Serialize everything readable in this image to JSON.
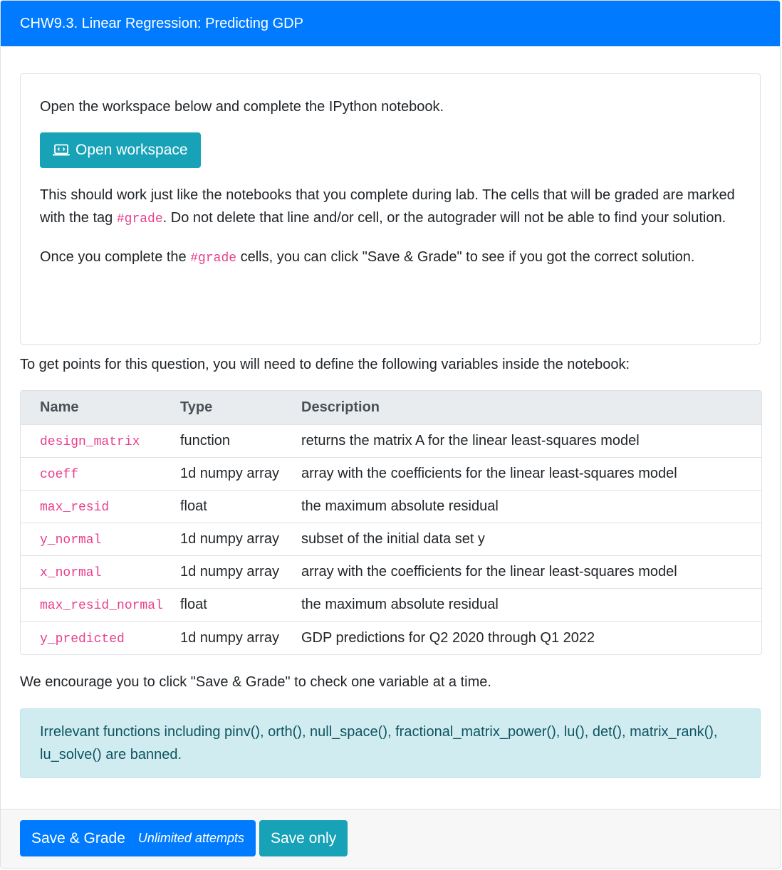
{
  "header": {
    "title": "CHW9.3. Linear Regression: Predicting GDP"
  },
  "workspace": {
    "intro": "Open the workspace below and complete the IPython notebook.",
    "button_label": "Open workspace",
    "para1_a": "This should work just like the notebooks that you complete during lab. The cells that will be graded are marked with the tag ",
    "para1_code": "#grade",
    "para1_b": ". Do not delete that line and/or cell, or the autograder will not be able to find your solution.",
    "para2_a": "Once you complete the ",
    "para2_code": "#grade",
    "para2_b": " cells, you can click \"Save & Grade\" to see if you got the correct solution."
  },
  "variables_intro": "To get points for this question, you will need to define the following variables inside the notebook:",
  "table": {
    "headers": [
      "Name",
      "Type",
      "Description"
    ],
    "rows": [
      {
        "name": "design_matrix",
        "type": "function",
        "description": "returns the matrix A for the linear least-squares model"
      },
      {
        "name": "coeff",
        "type": "1d numpy array",
        "description": "array with the coefficients for the linear least-squares model"
      },
      {
        "name": "max_resid",
        "type": "float",
        "description": "the maximum absolute residual"
      },
      {
        "name": "y_normal",
        "type": "1d numpy array",
        "description": "subset of the initial data set y"
      },
      {
        "name": "x_normal",
        "type": "1d numpy array",
        "description": "array with the coefficients for the linear least-squares model"
      },
      {
        "name": "max_resid_normal",
        "type": "float",
        "description": "the maximum absolute residual"
      },
      {
        "name": "y_predicted",
        "type": "1d numpy array",
        "description": "GDP predictions for Q2 2020 through Q1 2022"
      }
    ]
  },
  "encourage": "We encourage you to click \"Save & Grade\" to check one variable at a time.",
  "alert": {
    "text": "Irrelevant functions including pinv(), orth(), null_space(), fractional_matrix_power(), lu(), det(), matrix_rank(), lu_solve() are banned."
  },
  "footer": {
    "save_grade_label": "Save & Grade",
    "attempts_label": "Unlimited attempts",
    "save_only_label": "Save only"
  },
  "colors": {
    "primary": "#007bff",
    "info": "#17a2b8",
    "code": "#e83e8c",
    "alert_bg": "#d1ecf1",
    "alert_text": "#0c5460"
  }
}
